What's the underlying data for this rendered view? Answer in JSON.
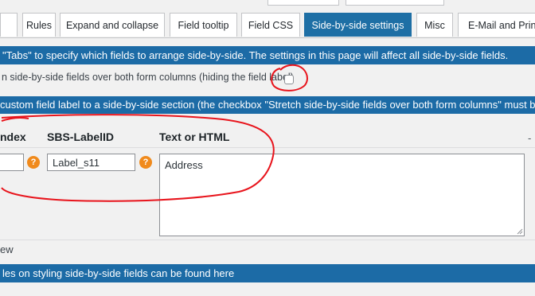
{
  "tabs": [
    {
      "label": "Rules",
      "active": false
    },
    {
      "label": "Expand and collapse",
      "active": false
    },
    {
      "label": "Field tooltip",
      "active": false
    },
    {
      "label": "Field CSS",
      "active": false
    },
    {
      "label": "Side-by-side settings",
      "active": true
    },
    {
      "label": "Misc",
      "active": false
    },
    {
      "label": "E-Mail and Print",
      "active": false
    }
  ],
  "info_bar_top": "\"Tabs\" to specify which fields to arrange side-by-side. The settings in this page will affect all side-by-side fields.",
  "stretch_option": {
    "label": "n side-by-side fields over both form columns (hiding the field label)",
    "checked": false
  },
  "info_bar_custom_label": "custom field label to a side-by-side section (the checkbox \"Stretch side-by-side fields over both form columns\" must b",
  "table": {
    "headers": {
      "index": "ndex",
      "sbs_label_id": "SBS-LabelID",
      "text_or_html": "Text or HTML"
    },
    "row": {
      "index_value": "",
      "sbs_label_id_value": "Label_s11",
      "text_or_html_value": "Address"
    },
    "help_icon_symbol": "?",
    "trailing_dash": "-"
  },
  "preview_label": "ew",
  "info_bar_bottom": "les on styling side-by-side fields can be found here",
  "colors": {
    "accent_blue": "#1c6ba6",
    "help_orange": "#f08a1c",
    "annotation_red": "#e8141c"
  }
}
